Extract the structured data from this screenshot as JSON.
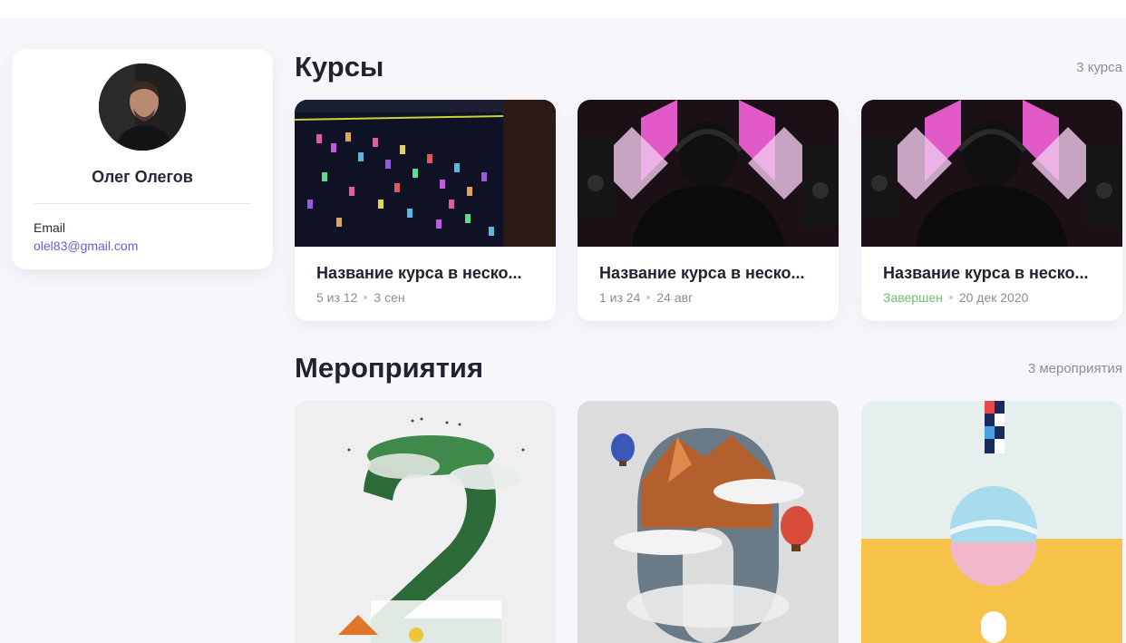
{
  "profile": {
    "name": "Олег Олегов",
    "email_label": "Email",
    "email": "olel83@gmail.com"
  },
  "courses": {
    "title": "Курсы",
    "count": "3 курса",
    "items": [
      {
        "title": "Название курса в неско...",
        "progress": "5 из 12",
        "date": "3 сен",
        "status": ""
      },
      {
        "title": "Название курса в неско...",
        "progress": "1 из 24",
        "date": "24 авг",
        "status": ""
      },
      {
        "title": "Название курса в неско...",
        "progress": "",
        "date": "20 дек 2020",
        "status": "Завершен"
      }
    ]
  },
  "events": {
    "title": "Мероприятия",
    "count": "3 мероприятия"
  },
  "colors": {
    "accent": "#6a5bd4",
    "completed": "#6cc26c",
    "background": "#f7f7fb"
  }
}
